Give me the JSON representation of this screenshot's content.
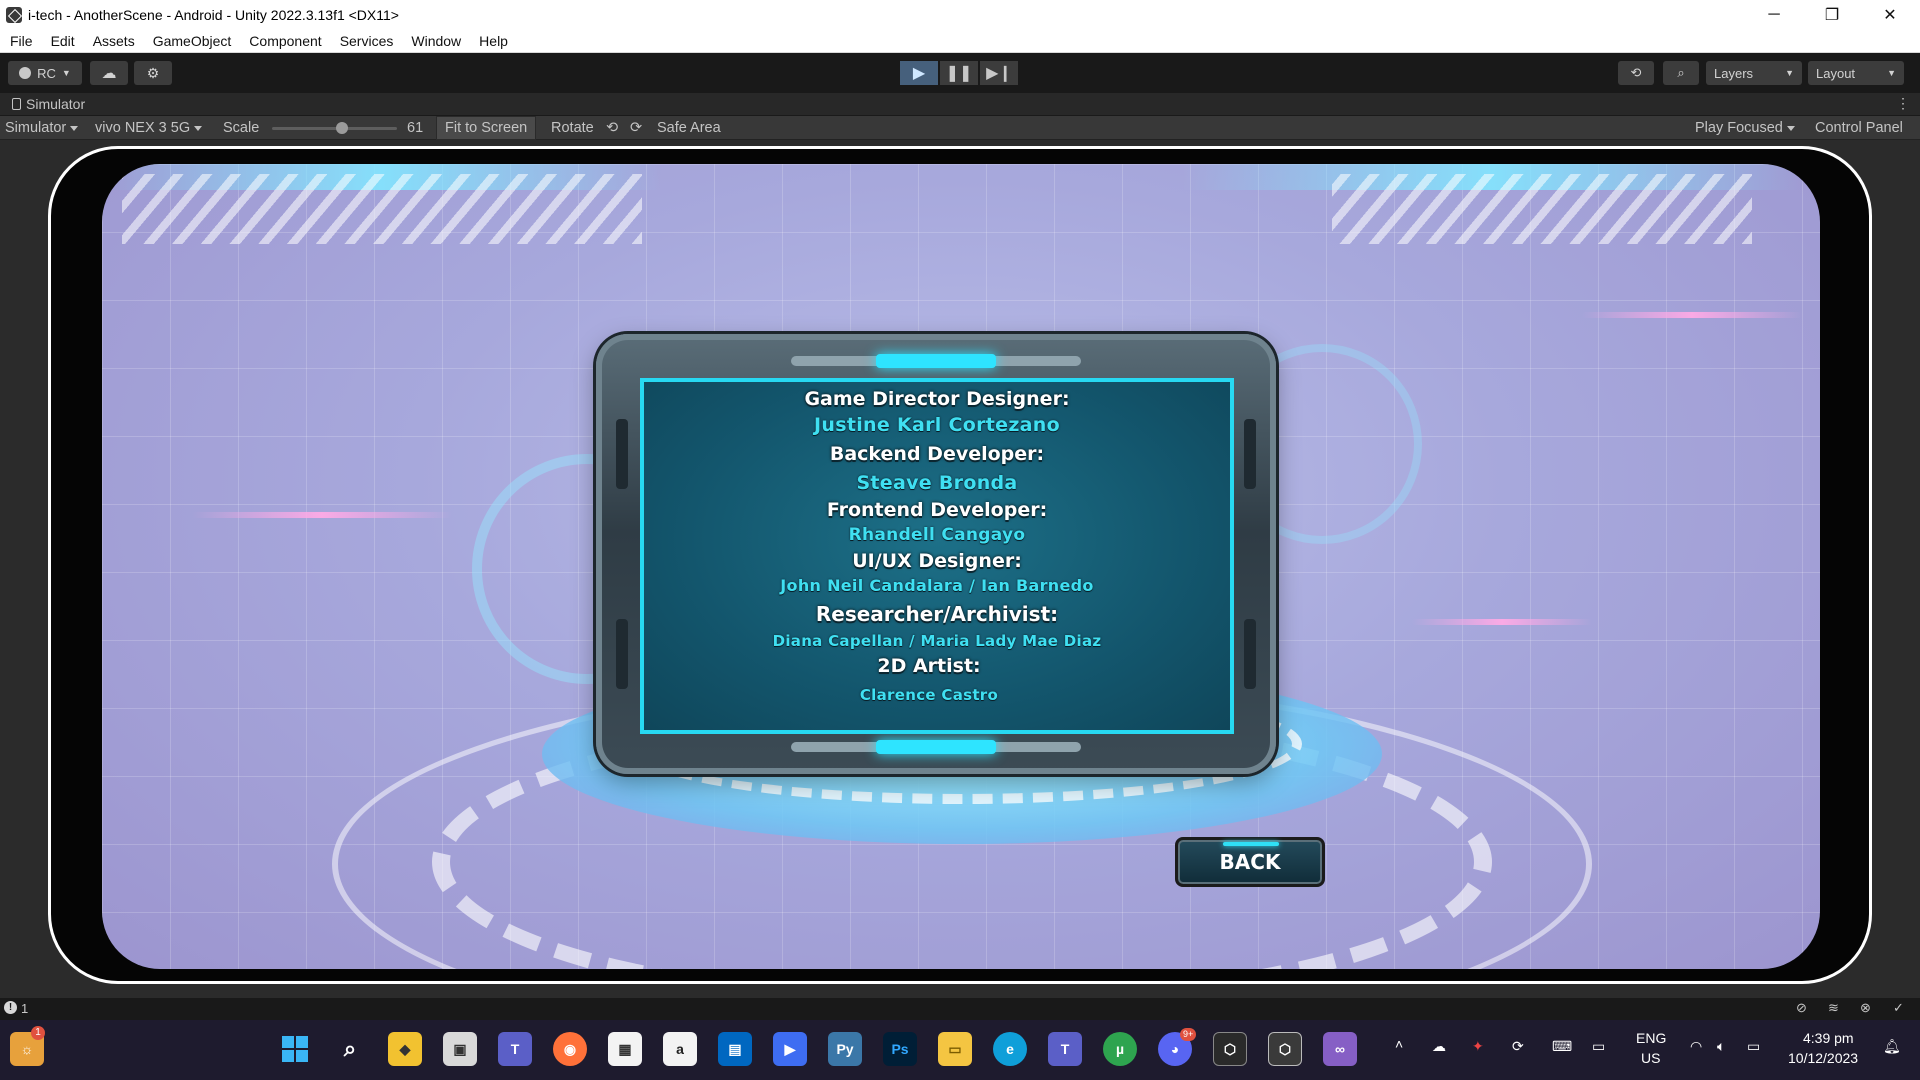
{
  "window": {
    "title": "i-tech - AnotherScene - Android - Unity 2022.3.13f1 <DX11>",
    "minimize_glyph": "─",
    "restore_glyph": "❐",
    "close_glyph": "✕"
  },
  "menu": {
    "items": [
      "File",
      "Edit",
      "Assets",
      "GameObject",
      "Component",
      "Services",
      "Window",
      "Help"
    ]
  },
  "toolbar": {
    "account_label": "RC",
    "layers_label": "Layers",
    "layout_label": "Layout",
    "play_state": "playing"
  },
  "simulator": {
    "tab_label": "Simulator",
    "mode_label": "Simulator",
    "device_label": "vivo NEX 3 5G",
    "scale_label": "Scale",
    "scale_value": "61",
    "fit_label": "Fit to Screen",
    "rotate_label": "Rotate",
    "safe_area_label": "Safe Area",
    "play_focused_label": "Play Focused",
    "control_panel_label": "Control Panel",
    "scale_fraction": 0.56
  },
  "game": {
    "credits": [
      {
        "role": "Game Director  Designer:",
        "name": "Justine Karl Cortezano"
      },
      {
        "role": "Backend Developer:",
        "name": "Steave Bronda"
      },
      {
        "role": "Frontend Developer:",
        "name": "Rhandell Cangayo"
      },
      {
        "role": "UI/UX Designer:",
        "name": "John Neil Candalara / Ian Barnedo"
      },
      {
        "role": "Researcher/Archivist:",
        "name": "Diana Capellan / Maria Lady Mae Diaz"
      },
      {
        "role": "2D Artist:",
        "name": "Clarence Castro"
      }
    ],
    "back_label": "BACK"
  },
  "status": {
    "console_count": "1"
  },
  "taskbar": {
    "language": "ENG",
    "region": "US",
    "time": "4:39 pm",
    "date": "10/12/2023",
    "notification_badge": "1",
    "discord_badge": "9+"
  },
  "colors": {
    "accent_cyan": "#27d9f2",
    "name_text": "#3fe0f2",
    "panel_bg": "#13566d",
    "unity_dark": "#191919"
  }
}
